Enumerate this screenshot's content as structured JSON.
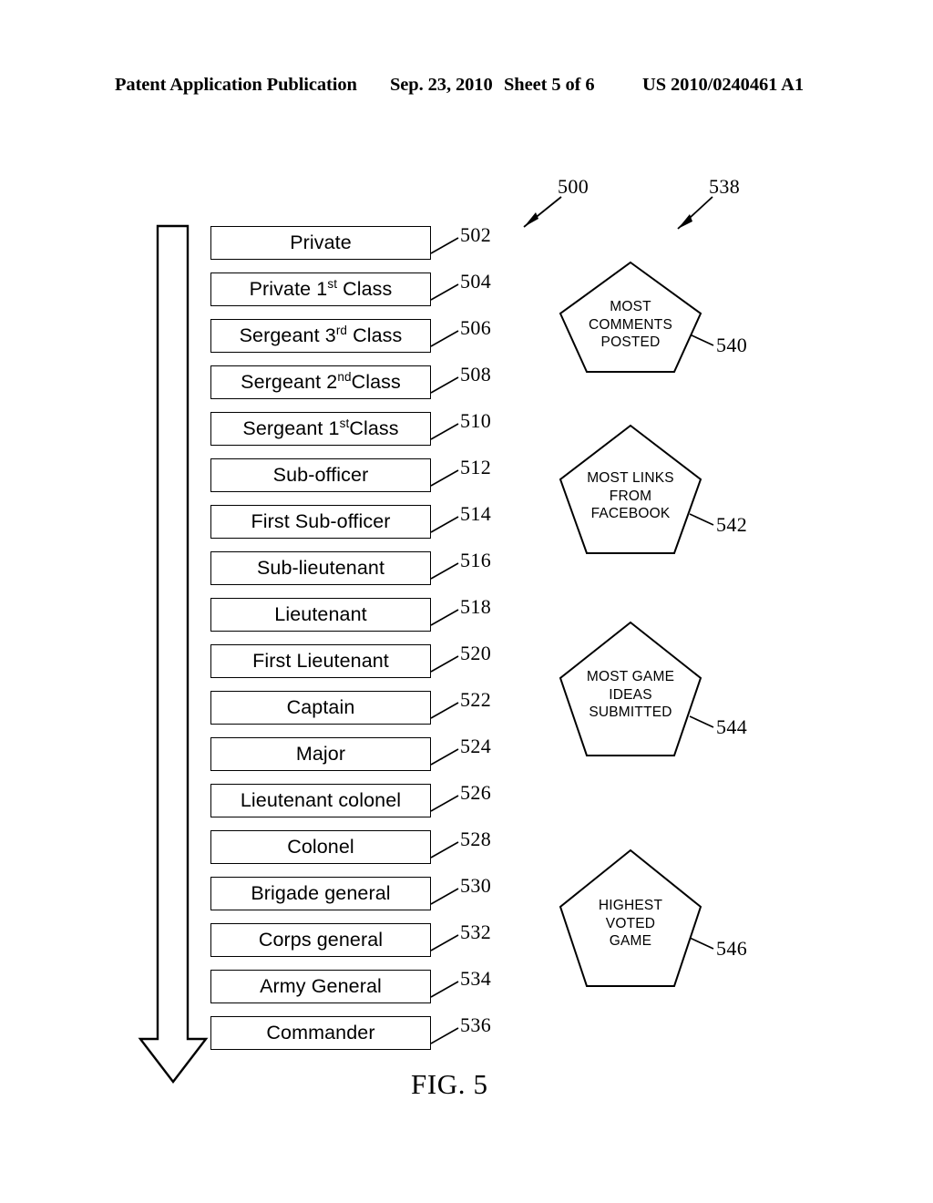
{
  "header": {
    "publication": "Patent Application Publication",
    "date": "Sep. 23, 2010",
    "sheet": "Sheet 5 of 6",
    "patent_number": "US 2010/0240461 A1"
  },
  "figure": {
    "caption": "FIG. 5",
    "progression_arrow_name": "rank-progression-arrow",
    "callouts": [
      {
        "ref": "500",
        "target": "rank-ladder"
      },
      {
        "ref": "538",
        "target": "badge-group"
      }
    ]
  },
  "rank_ladder": {
    "ref": "500",
    "ranks": [
      {
        "ref": "502",
        "label": "Private"
      },
      {
        "ref": "504",
        "label": "Private 1",
        "sup": "st",
        "label_tail": " Class"
      },
      {
        "ref": "506",
        "label": "Sergeant 3",
        "sup": "rd",
        "label_tail": " Class"
      },
      {
        "ref": "508",
        "label": "Sergeant 2",
        "sup": "nd",
        "label_tail": "Class"
      },
      {
        "ref": "510",
        "label": "Sergeant 1",
        "sup": "st",
        "label_tail": "Class"
      },
      {
        "ref": "512",
        "label": "Sub-officer"
      },
      {
        "ref": "514",
        "label": "First Sub-officer"
      },
      {
        "ref": "516",
        "label": "Sub-lieutenant"
      },
      {
        "ref": "518",
        "label": "Lieutenant"
      },
      {
        "ref": "520",
        "label": "First Lieutenant"
      },
      {
        "ref": "522",
        "label": "Captain"
      },
      {
        "ref": "524",
        "label": "Major"
      },
      {
        "ref": "526",
        "label": "Lieutenant colonel"
      },
      {
        "ref": "528",
        "label": "Colonel"
      },
      {
        "ref": "530",
        "label": "Brigade general"
      },
      {
        "ref": "532",
        "label": "Corps general"
      },
      {
        "ref": "534",
        "label": "Army General"
      },
      {
        "ref": "536",
        "label": "Commander"
      }
    ]
  },
  "badge_group": {
    "ref": "538",
    "badges": [
      {
        "ref": "540",
        "text": "MOST\nCOMMENTS\nPOSTED"
      },
      {
        "ref": "542",
        "text": "MOST LINKS\nFROM\nFACEBOOK"
      },
      {
        "ref": "544",
        "text": "MOST GAME\nIDEAS\nSUBMITTED"
      },
      {
        "ref": "546",
        "text": "HIGHEST\nVOTED\nGAME"
      }
    ]
  },
  "colors": {
    "line": "#000000",
    "background": "#ffffff"
  }
}
